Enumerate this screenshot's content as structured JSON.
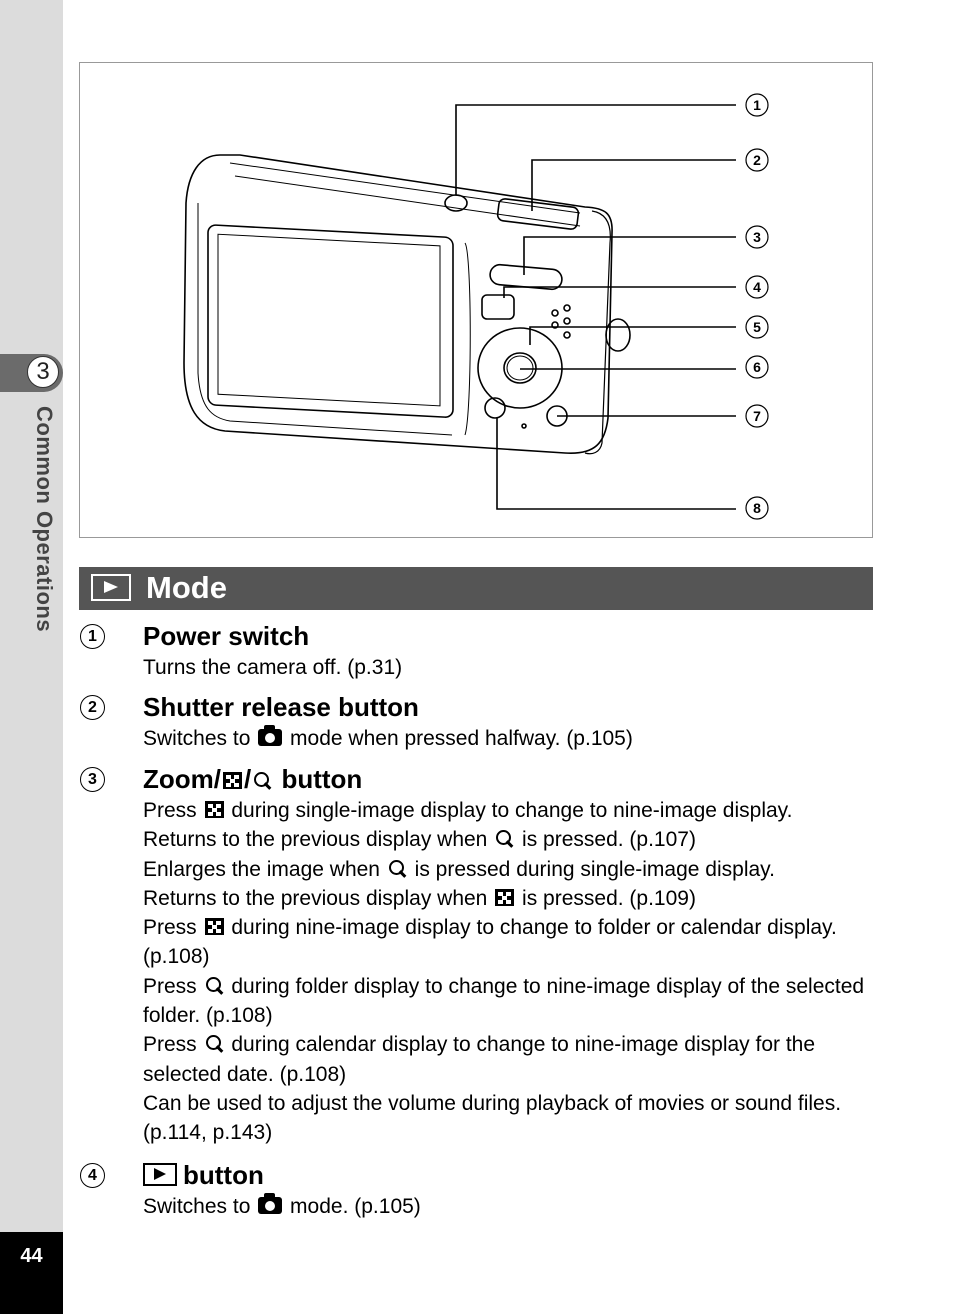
{
  "sidebar": {
    "chapter_number": "3",
    "chapter_title": "Common Operations",
    "page_number": "44"
  },
  "figure": {
    "callouts": [
      "1",
      "2",
      "3",
      "4",
      "5",
      "6",
      "7",
      "8"
    ]
  },
  "section": {
    "icon": "playback-icon",
    "title": "Mode"
  },
  "items": [
    {
      "number": "1",
      "title": "Power switch",
      "lines": [
        {
          "parts": [
            "Turns the camera off. (p.31)"
          ]
        }
      ]
    },
    {
      "number": "2",
      "title": "Shutter release button",
      "lines": [
        {
          "parts": [
            "Switches to ",
            "{camera-icon}",
            " mode when pressed halfway. (p.105)"
          ],
          "before": "Switches to ",
          "after": " mode when pressed halfway. (p.105)"
        }
      ]
    },
    {
      "number": "3",
      "title_prefix": "Zoom/",
      "title_mid": "/",
      "title_suffix": " button",
      "lines": [
        {
          "before": "Press ",
          "icon": "grid-icon",
          "after": " during single-image display to change to nine-image display."
        },
        {
          "before": "Returns to the previous display when ",
          "icon": "zoom-icon",
          "after": " is pressed. (p.107)"
        },
        {
          "before": "Enlarges the image when ",
          "icon": "zoom-icon",
          "after": " is pressed during single-image display."
        },
        {
          "before": "Returns to the previous display when ",
          "icon": "grid-icon",
          "after": " is pressed. (p.109)"
        },
        {
          "before": "Press ",
          "icon": "grid-icon",
          "after": " during nine-image display to change to folder or calendar display. (p.108)"
        },
        {
          "before": "Press ",
          "icon": "zoom-icon",
          "after": " during folder display to change to nine-image display of the selected folder. (p.108)"
        },
        {
          "before": "Press ",
          "icon": "zoom-icon",
          "after": " during calendar display to change to nine-image display for the selected date. (p.108)"
        },
        {
          "text": "Can be used to adjust the volume during playback of movies or sound files. (p.114, p.143)"
        }
      ]
    },
    {
      "number": "4",
      "title": "button",
      "lines": [
        {
          "before": "Switches to ",
          "icon": "camera-icon",
          "after": " mode. (p.105)"
        }
      ]
    }
  ]
}
